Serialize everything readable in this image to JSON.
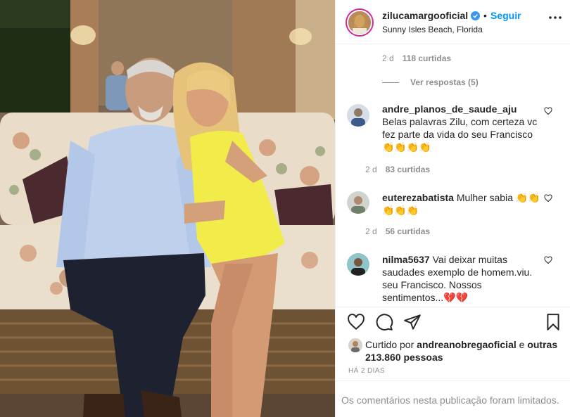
{
  "post": {
    "username": "zilucamargooficial",
    "separator": "•",
    "follow_label": "Seguir",
    "location": "Sunny Isles Beach, Florida"
  },
  "top_reply_meta": {
    "time": "2 d",
    "likes": "118 curtidas"
  },
  "view_replies": "Ver respostas (5)",
  "comments": [
    {
      "username": "andre_planos_de_saude_aju",
      "text": "Belas palavras Zilu, com certeza vc fez parte da vida do seu Francisco 👏👏👏👏",
      "time": "2 d",
      "likes": "83 curtidas"
    },
    {
      "username": "euterezabatista",
      "text": "Mulher sabia 👏👏👏👏👏",
      "time": "2 d",
      "likes": "56 curtidas"
    },
    {
      "username": "nilma5637",
      "text": "Vai deixar muitas saudades exemplo de homem.viu. seu Francisco. Nossos sentimentos...💔💔",
      "time": "",
      "likes": ""
    }
  ],
  "liked_by": {
    "prefix": "Curtido por",
    "user": "andreanobregaoficial",
    "conj": "e",
    "others": "outras 213.860 pessoas"
  },
  "timestamp": "HÁ 2 DIAS",
  "footer_note": "Os comentários nesta publicação foram limitados.",
  "icons": {
    "verified": "verified-badge-icon",
    "more": "more-options-icon",
    "heart": "heart-icon",
    "comment": "comment-icon",
    "share": "share-icon",
    "save": "bookmark-icon"
  },
  "colors": {
    "accent": "#0095f6",
    "muted": "#8e8e8e",
    "text": "#262626",
    "dress": "#f2ec4a"
  }
}
